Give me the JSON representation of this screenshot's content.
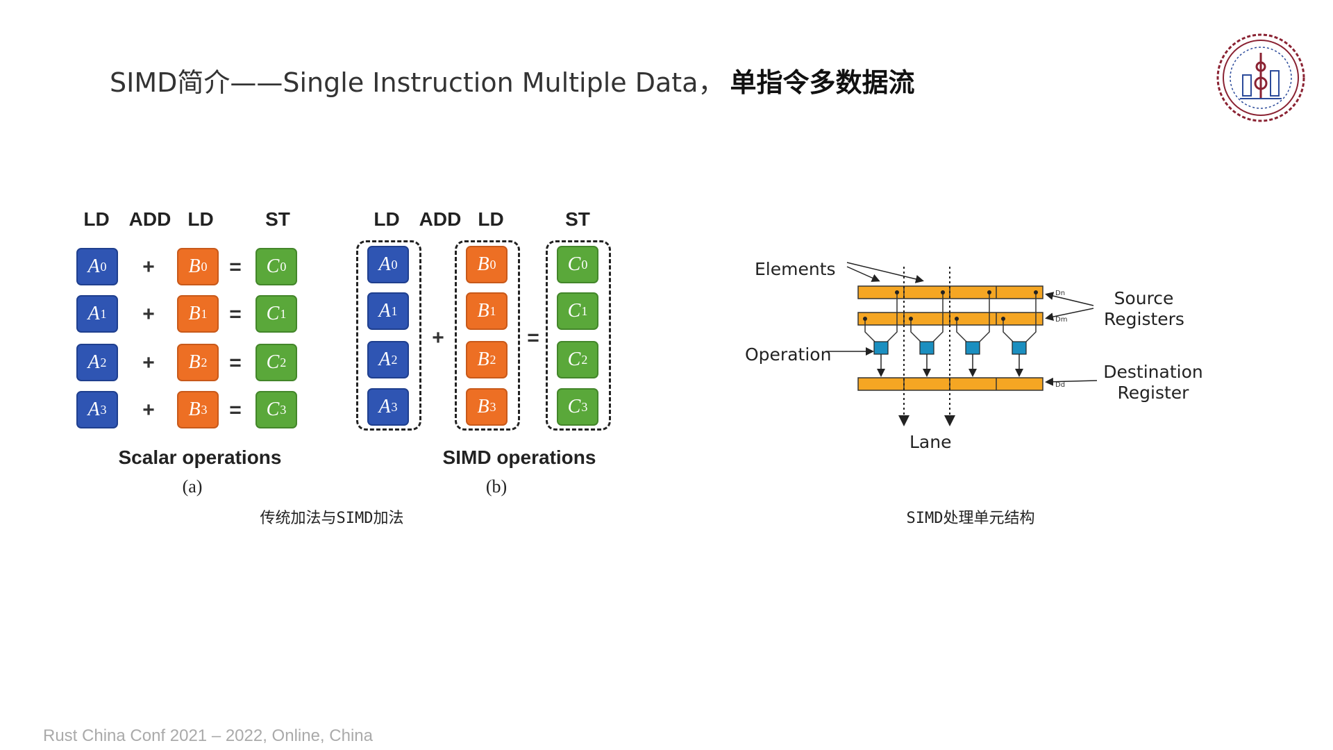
{
  "slide": {
    "title_prefix": "SIMD简介——Single Instruction Multiple Data，",
    "title_bold": "单指令多数据流",
    "footer": "Rust China Conf 2021 – 2022, Online, China",
    "logo_icon": "conference-seal-icon"
  },
  "figure_left": {
    "caption": "传统加法与SIMD加法",
    "scalar": {
      "headers": [
        "LD",
        "ADD",
        "LD",
        "ST"
      ],
      "a": [
        {
          "base": "A",
          "sub": "0"
        },
        {
          "base": "A",
          "sub": "1"
        },
        {
          "base": "A",
          "sub": "2"
        },
        {
          "base": "A",
          "sub": "3"
        }
      ],
      "b": [
        {
          "base": "B",
          "sub": "0"
        },
        {
          "base": "B",
          "sub": "1"
        },
        {
          "base": "B",
          "sub": "2"
        },
        {
          "base": "B",
          "sub": "3"
        }
      ],
      "c": [
        {
          "base": "C",
          "sub": "0"
        },
        {
          "base": "C",
          "sub": "1"
        },
        {
          "base": "C",
          "sub": "2"
        },
        {
          "base": "C",
          "sub": "3"
        }
      ],
      "plus": "+",
      "equals": "=",
      "title": "Scalar operations",
      "sublabel": "(a)"
    },
    "simd": {
      "headers": [
        "LD",
        "ADD",
        "LD",
        "ST"
      ],
      "a": [
        {
          "base": "A",
          "sub": "0"
        },
        {
          "base": "A",
          "sub": "1"
        },
        {
          "base": "A",
          "sub": "2"
        },
        {
          "base": "A",
          "sub": "3"
        }
      ],
      "b": [
        {
          "base": "B",
          "sub": "0"
        },
        {
          "base": "B",
          "sub": "1"
        },
        {
          "base": "B",
          "sub": "2"
        },
        {
          "base": "B",
          "sub": "3"
        }
      ],
      "c": [
        {
          "base": "C",
          "sub": "0"
        },
        {
          "base": "C",
          "sub": "1"
        },
        {
          "base": "C",
          "sub": "2"
        },
        {
          "base": "C",
          "sub": "3"
        }
      ],
      "plus": "+",
      "equals": "=",
      "title": "SIMD operations",
      "sublabel": "(b)"
    },
    "colors": {
      "a": "#2f55b3",
      "b": "#ed6f24",
      "c": "#5aa83a"
    }
  },
  "figure_right": {
    "caption": "SIMD处理单元结构",
    "labels": {
      "elements": "Elements",
      "source": "Source\nRegisters",
      "operation": "Operation",
      "destination": "Destination\nRegister",
      "lane": "Lane",
      "dn": "Dn",
      "dm": "Dm",
      "dd": "Dd"
    },
    "colors": {
      "register": "#f5a623",
      "op_unit": "#1b8fc0"
    }
  }
}
